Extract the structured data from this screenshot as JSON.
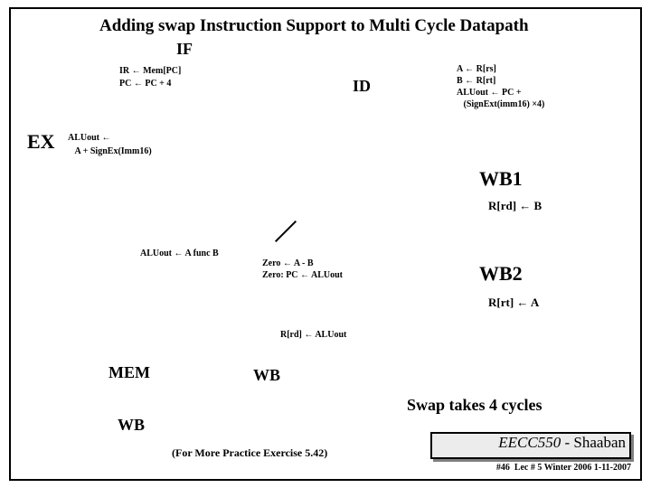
{
  "title": "Adding swap  Instruction Support to Multi Cycle Datapath",
  "stages": {
    "if": {
      "label": "IF",
      "lines": {
        "l1": "IR ← Mem[PC]",
        "l2": "PC ← PC + 4"
      }
    },
    "id": {
      "label": "ID",
      "lines": {
        "l1": "A ← R[rs]",
        "l2": "B ← R[rt]",
        "l3": "ALUout ← PC +",
        "l4": "(SignExt(imm16) ×4)"
      }
    },
    "ex": {
      "label": "EX",
      "lines": {
        "l1": "ALUout ←",
        "l2": "A + SignEx(Imm16)"
      }
    },
    "wb1": {
      "label": "WB1",
      "line": "R[rd] ← B"
    },
    "func": {
      "line": "ALUout ← A func B"
    },
    "zero": {
      "l1": "Zero ← A - B",
      "l2": "Zero: PC ← ALUout"
    },
    "wb2": {
      "label": "WB2",
      "line": "R[rt] ← A"
    },
    "rrd": {
      "line": "R[rd] ← ALUout"
    },
    "mem": {
      "label": "MEM"
    },
    "wb": {
      "label": "WB"
    },
    "wb_bottom": {
      "label": "WB"
    }
  },
  "notes": {
    "swap": "Swap takes 4 cycles",
    "exercise": "(For More Practice Exercise 5.42)"
  },
  "course": {
    "code": "EECC550",
    "dash": " - ",
    "name": "Shaaban"
  },
  "footer": {
    "page": "#46",
    "lec": "Lec # 5 Winter 2006 1-11-2007"
  }
}
